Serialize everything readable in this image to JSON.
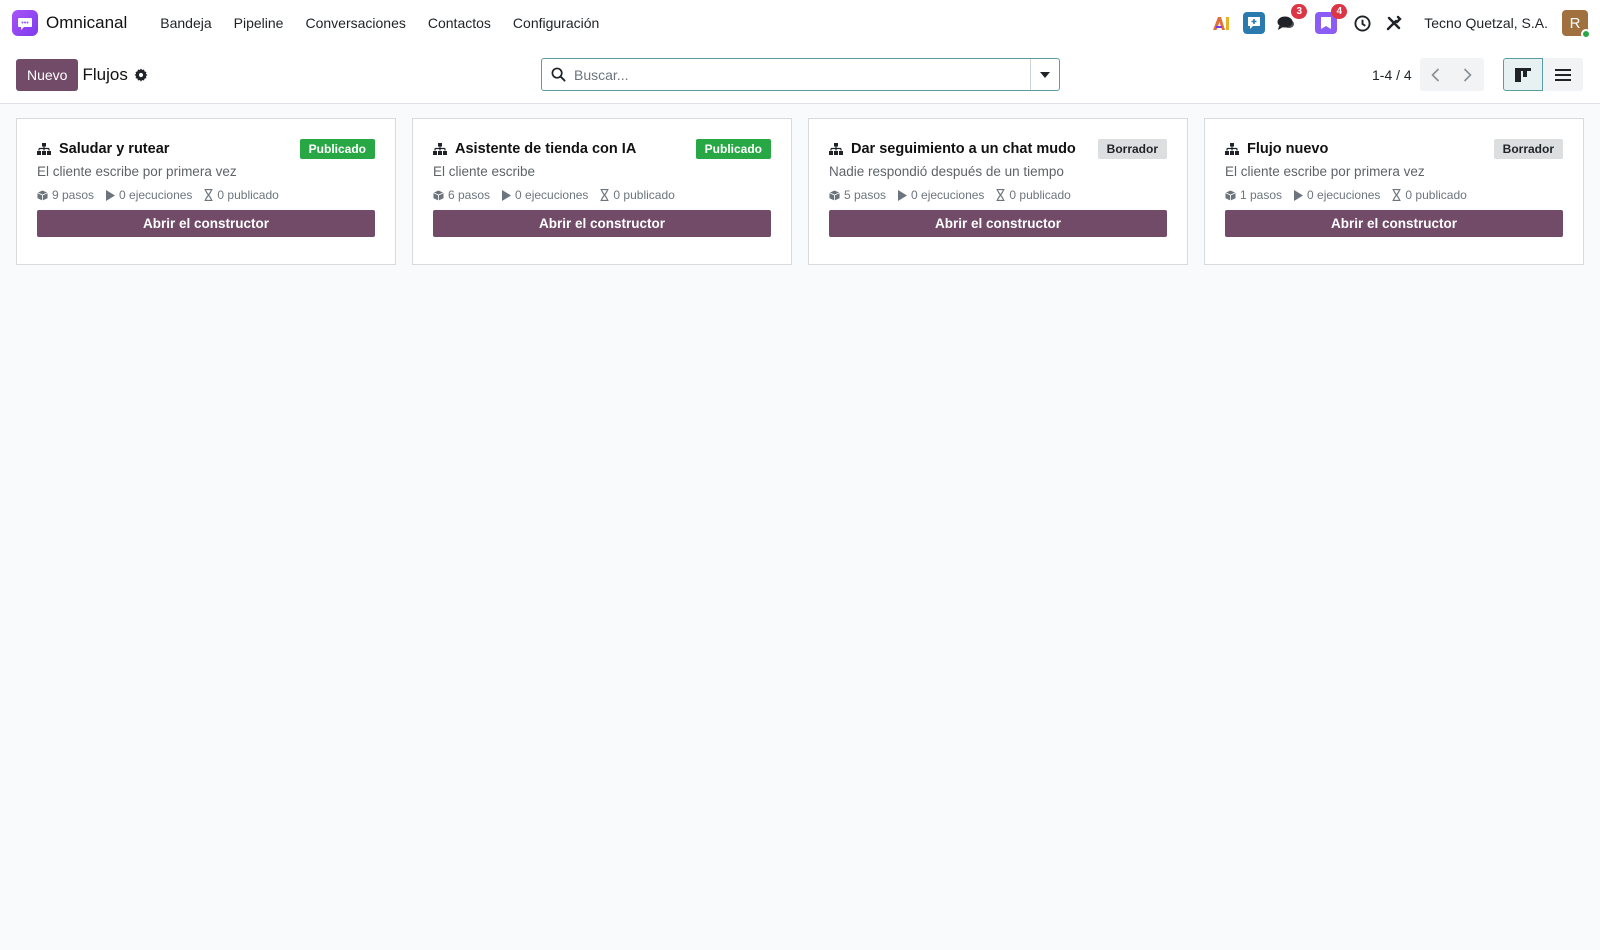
{
  "navbar": {
    "app_name": "Omnicanal",
    "menu": [
      "Bandeja",
      "Pipeline",
      "Conversaciones",
      "Contactos",
      "Configuración"
    ],
    "chat_count": "3",
    "activity_count": "4",
    "company": "Tecno Quetzal, S.A.",
    "user_initial": "R"
  },
  "control_panel": {
    "new_label": "Nuevo",
    "title": "Flujos",
    "search_placeholder": "Buscar...",
    "pager": "1-4 / 4"
  },
  "cards": [
    {
      "title": "Saludar y rutear",
      "status": "Publicado",
      "status_type": "published",
      "trigger": "El cliente escribe por primera vez",
      "steps": "9 pasos",
      "runs": "0 ejecuciones",
      "published": "0 publicado",
      "button": "Abrir el constructor"
    },
    {
      "title": "Asistente de tienda con IA",
      "status": "Publicado",
      "status_type": "published",
      "trigger": "El cliente escribe",
      "steps": "6 pasos",
      "runs": "0 ejecuciones",
      "published": "0 publicado",
      "button": "Abrir el constructor"
    },
    {
      "title": "Dar seguimiento a un chat mudo",
      "status": "Borrador",
      "status_type": "draft",
      "trigger": "Nadie respondió después de un tiempo",
      "steps": "5 pasos",
      "runs": "0 ejecuciones",
      "published": "0 publicado",
      "button": "Abrir el constructor"
    },
    {
      "title": "Flujo nuevo",
      "status": "Borrador",
      "status_type": "draft",
      "trigger": "El cliente escribe por primera vez",
      "steps": "1 pasos",
      "runs": "0 ejecuciones",
      "published": "0 publicado",
      "button": "Abrir el constructor"
    }
  ],
  "colors": {
    "primary": "#714b67",
    "published": "#28a745",
    "draft": "#dcdee0",
    "accent": "#5a9ea1"
  },
  "icons": {
    "app": "chat-bubble-icon",
    "flow": "sitemap-icon",
    "steps": "cube-icon",
    "runs": "play-icon",
    "published": "hourglass-icon"
  }
}
